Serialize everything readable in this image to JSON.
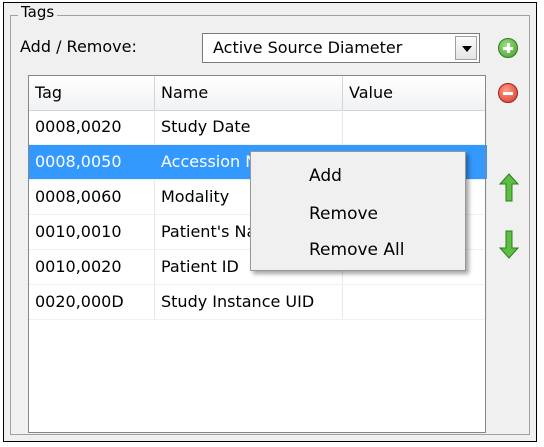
{
  "group": {
    "title": "Tags"
  },
  "add_remove": {
    "label": "Add / Remove:",
    "combo_value": "Active Source Diameter"
  },
  "buttons": {
    "add_icon": "plus-circle-icon",
    "remove_icon": "minus-circle-icon",
    "move_up_icon": "arrow-up-icon",
    "move_down_icon": "arrow-down-icon"
  },
  "table": {
    "headers": [
      "Tag",
      "Name",
      "Value"
    ],
    "rows": [
      {
        "tag": "0008,0020",
        "name": "Study Date",
        "value": ""
      },
      {
        "tag": "0008,0050",
        "name": "Accession Number",
        "value": ""
      },
      {
        "tag": "0008,0060",
        "name": "Modality",
        "value": ""
      },
      {
        "tag": "0010,0010",
        "name": "Patient's Name",
        "value": ""
      },
      {
        "tag": "0010,0020",
        "name": "Patient ID",
        "value": ""
      },
      {
        "tag": "0020,000D",
        "name": "Study Instance UID",
        "value": ""
      }
    ],
    "selected_row": 1
  },
  "context_menu": {
    "items": [
      "Add",
      "Remove",
      "Remove All"
    ]
  },
  "colors": {
    "selection": "#3399ff",
    "panel_bg": "#f0f0f0",
    "add_green": "#3fa12a",
    "remove_red": "#d6382a",
    "arrow_green": "#3f9b2b"
  }
}
